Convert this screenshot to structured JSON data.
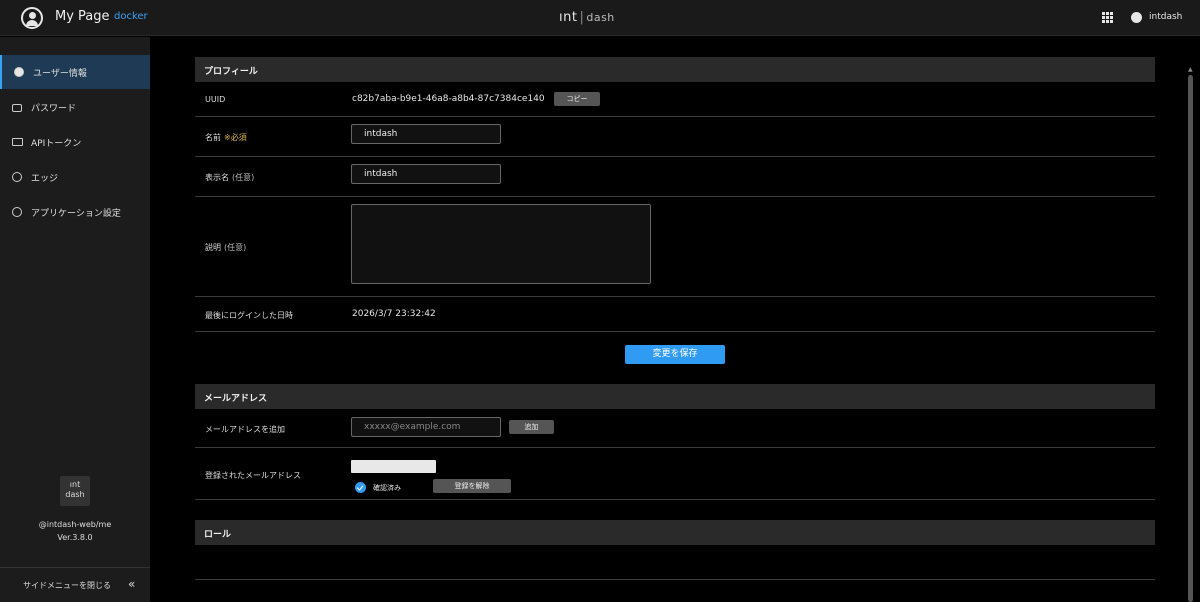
{
  "header": {
    "title": "My Page",
    "env": "docker",
    "logo_main": "ınt",
    "logo_sub": "dash",
    "user": "intdash"
  },
  "sidebar": {
    "items": [
      {
        "label": "ユーザー情報"
      },
      {
        "label": "パスワード"
      },
      {
        "label": "APIトークン"
      },
      {
        "label": "エッジ"
      },
      {
        "label": "アプリケーション設定"
      }
    ],
    "logo_line1": "ınt",
    "logo_line2": "dash",
    "path": "@intdash-web/me",
    "version": "Ver.3.8.0",
    "close_label": "サイドメニューを閉じる",
    "collapse_glyph": "«"
  },
  "profile": {
    "heading": "プロフィール",
    "uuid_label": "UUID",
    "uuid_value": "c82b7aba-b9e1-46a8-a8b4-87c7384ce140",
    "copy_label": "コピー",
    "name_label": "名前",
    "required_mark": "※必須",
    "name_value": "intdash",
    "display_name_label": "表示名",
    "optional_mark": "(任意)",
    "display_name_value": "intdash",
    "description_label": "説明",
    "last_login_label": "最後にログインした日時",
    "last_login_value": "2026/3/7 23:32:42",
    "save_label": "変更を保存"
  },
  "email": {
    "heading": "メールアドレス",
    "add_label": "メールアドレスを追加",
    "add_placeholder": "xxxxx@example.com",
    "add_button": "追加",
    "registered_label": "登録されたメールアドレス",
    "verified_label": "確認済み",
    "unregister_button": "登録を解除"
  },
  "role": {
    "heading": "ロール"
  }
}
